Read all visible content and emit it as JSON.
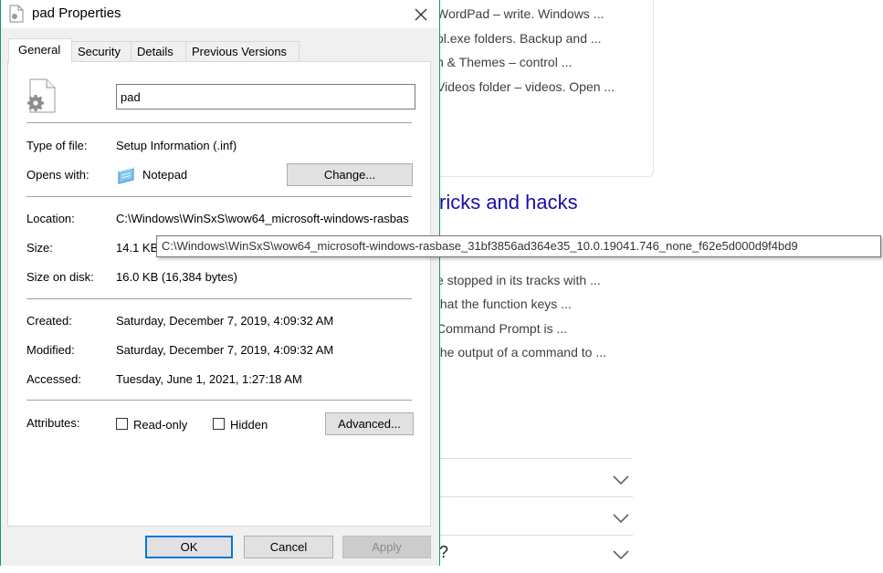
{
  "background": {
    "card_lines": [
      "WordPad – write. Windows ...",
      "ol.exe folders. Backup and ...",
      "n & Themes – control ...",
      "Videos folder – videos. Open ..."
    ],
    "heading": "ricks and hacks",
    "lines": [
      "e stopped in its tracks with ...",
      "that the function keys ...",
      "Command Prompt is ...",
      "the output of a command to ..."
    ],
    "accordion_last_text": "?"
  },
  "dialog": {
    "title": "pad Properties",
    "tabs": [
      "General",
      "Security",
      "Details",
      "Previous Versions"
    ],
    "file_name": "pad",
    "type_of_file": {
      "label": "Type of file:",
      "value": "Setup Information (.inf)"
    },
    "opens_with": {
      "label": "Opens with:",
      "value": "Notepad",
      "button": "Change..."
    },
    "location": {
      "label": "Location:",
      "value": "C:\\Windows\\WinSxS\\wow64_microsoft-windows-rasbas"
    },
    "size": {
      "label": "Size:",
      "value": "14.1 KB"
    },
    "size_on_disk": {
      "label": "Size on disk:",
      "value": "16.0 KB (16,384 bytes)"
    },
    "created": {
      "label": "Created:",
      "value": "Saturday, December 7, 2019, 4:09:32 AM"
    },
    "modified": {
      "label": "Modified:",
      "value": "Saturday, December 7, 2019, 4:09:32 AM"
    },
    "accessed": {
      "label": "Accessed:",
      "value": "Tuesday, June 1, 2021, 1:27:18 AM"
    },
    "attributes": {
      "label": "Attributes:",
      "read_only": "Read-only",
      "hidden": "Hidden",
      "advanced": "Advanced..."
    },
    "buttons": {
      "ok": "OK",
      "cancel": "Cancel",
      "apply": "Apply"
    }
  },
  "tooltip": "C:\\Windows\\WinSxS\\wow64_microsoft-windows-rasbase_31bf3856ad364e35_10.0.19041.746_none_f62e5d000d9f4bd9",
  "colors": {
    "accent_border": "#1c9a5a",
    "link": "#1a0dab",
    "primary_button": "#0078d7"
  }
}
